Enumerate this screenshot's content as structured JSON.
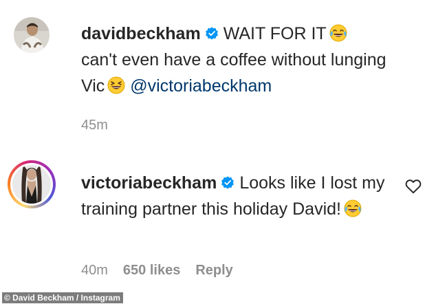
{
  "comments": [
    {
      "username": "davidbeckham",
      "text_part1": "WAIT FOR IT",
      "text_part2": "can't even have a coffee without lunging Vic",
      "mention": "@victoriabeckham",
      "time": "45m"
    },
    {
      "username": "victoriabeckham",
      "text_part1": "Looks like I lost my training partner this holiday David!",
      "time": "40m",
      "likes": "650 likes",
      "reply_label": "Reply"
    }
  ],
  "caption": "© David Beckham / Instagram",
  "colors": {
    "text": "#262626",
    "muted": "#8e8e8e",
    "mention": "#00376b",
    "verified": "#0095f6"
  },
  "icons": [
    "verified-badge-icon",
    "tears-of-joy-emoji-icon",
    "squinting-laugh-emoji-icon",
    "heart-outline-icon"
  ]
}
